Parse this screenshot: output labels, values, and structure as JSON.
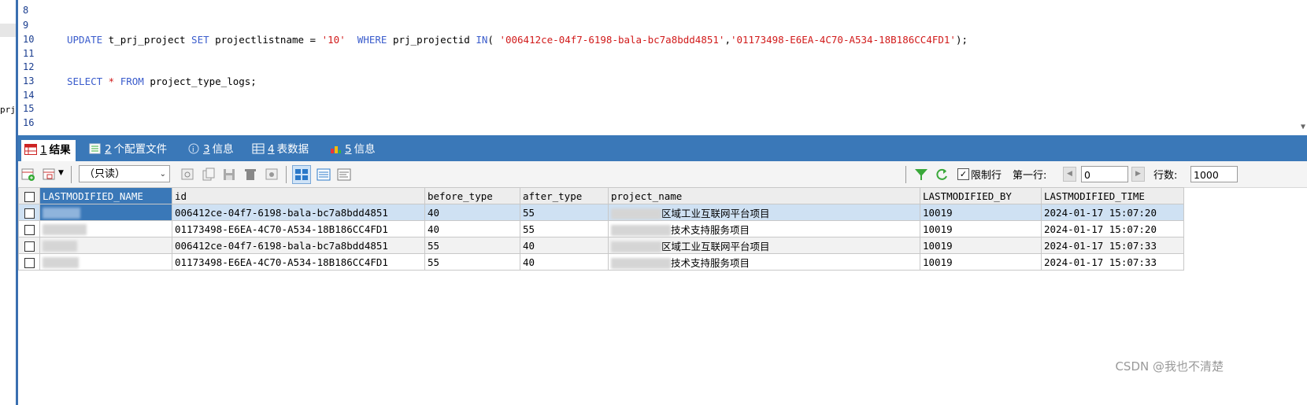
{
  "editor": {
    "line_numbers": [
      "8",
      "9",
      "10",
      "11",
      "12",
      "13",
      "14",
      "15",
      "16"
    ],
    "line10": {
      "kw_update": "UPDATE",
      "p1": " t_prj_project ",
      "kw_set": "SET",
      "p2": " projectlistname = ",
      "s1": "'10'",
      "kw_where": "WHERE",
      "p3": " prj_projectid ",
      "kw_in": "IN",
      "p4": "( ",
      "s2": "'006412ce-04f7-6198-bala-bc7a8bdd4851'",
      "p5": ",",
      "s3": "'01173498-E6EA-4C70-A534-18B186CC4FD1'",
      "p6": ");"
    },
    "line13": {
      "kw_select": "SELECT",
      "p1": " * ",
      "kw_from": "FROM",
      "p2": " project_type_logs;"
    },
    "left_fragment": "prj"
  },
  "tabs": [
    {
      "num": "1",
      "label": "结果",
      "icon": "result-grid-icon"
    },
    {
      "num": "2",
      "label": "个配置文件",
      "icon": "profile-icon"
    },
    {
      "num": "3",
      "label": "信息",
      "icon": "info-icon"
    },
    {
      "num": "4",
      "label": "表数据",
      "icon": "table-data-icon"
    },
    {
      "num": "5",
      "label": "信息",
      "icon": "history-info-icon"
    }
  ],
  "toolbar": {
    "mode": "（只读）",
    "limit_label": "限制行",
    "first_row_label": "第一行:",
    "first_row_value": "0",
    "rows_label": "行数:",
    "rows_value": "1000",
    "limit_checked": true
  },
  "grid": {
    "columns": [
      "LASTMODIFIED_NAME",
      "id",
      "before_type",
      "after_type",
      "project_name",
      "LASTMODIFIED_BY",
      "LASTMODIFIED_TIME"
    ],
    "rows": [
      {
        "name": "",
        "id": "006412ce-04f7-6198-bala-bc7a8bdd4851",
        "before": "40",
        "after": "55",
        "project": "区域工业互联网平台项目",
        "by": "10019",
        "time": "2024-01-17 15:07:20"
      },
      {
        "name": "",
        "id": "01173498-E6EA-4C70-A534-18B186CC4FD1",
        "before": "40",
        "after": "55",
        "project": "技术支持服务项目",
        "by": "10019",
        "time": "2024-01-17 15:07:20"
      },
      {
        "name": "",
        "id": "006412ce-04f7-6198-bala-bc7a8bdd4851",
        "before": "55",
        "after": "40",
        "project": "区域工业互联网平台项目",
        "by": "10019",
        "time": "2024-01-17 15:07:33"
      },
      {
        "name": "",
        "id": "01173498-E6EA-4C70-A534-18B186CC4FD1",
        "before": "55",
        "after": "40",
        "project": "技术支持服务项目",
        "by": "10019",
        "time": "2024-01-17 15:07:33"
      }
    ]
  },
  "watermark": "CSDN @我也不清楚",
  "colors": {
    "accent": "#3a78b8",
    "keyword": "#3a5ccc",
    "string": "#d11a1a",
    "line_number": "#1a3d8f"
  }
}
